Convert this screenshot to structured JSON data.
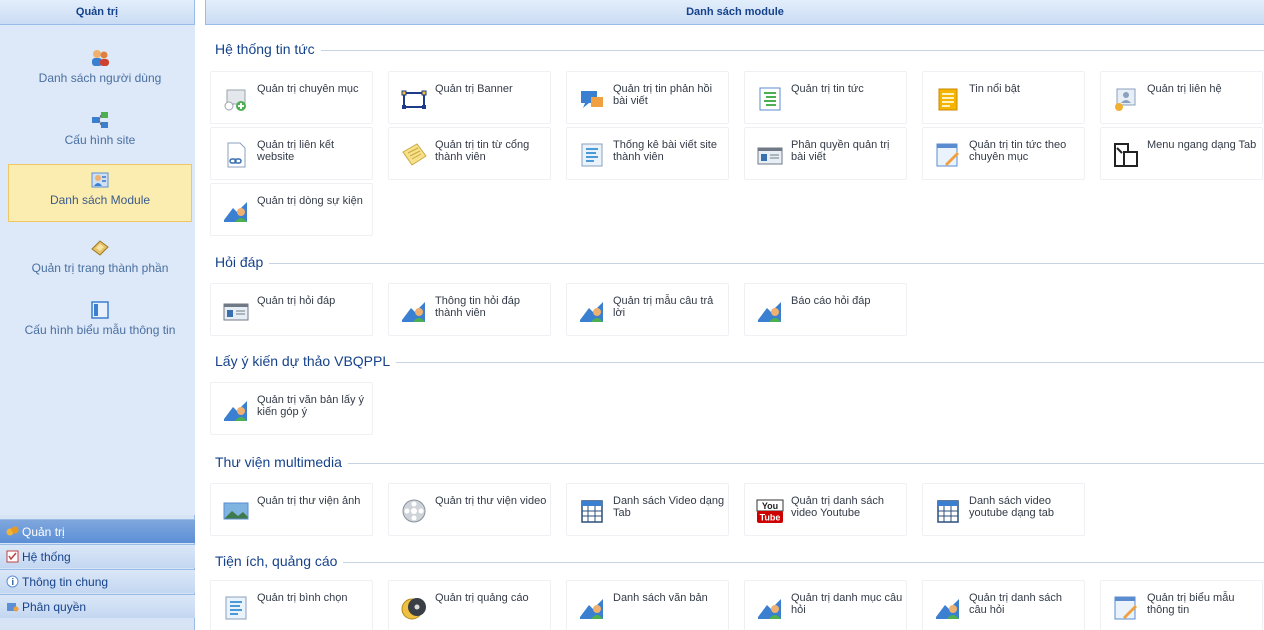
{
  "sidebar": {
    "title": "Quản trị",
    "items": [
      {
        "label": "Danh sách người dùng",
        "icon": "users-icon"
      },
      {
        "label": "Cấu hình site",
        "icon": "site-config-icon"
      },
      {
        "label": "Danh sách Module",
        "icon": "module-list-icon"
      },
      {
        "label": "Quản trị trang thành phần",
        "icon": "component-page-icon"
      },
      {
        "label": "Cấu hình biểu mẫu thông tin",
        "icon": "form-config-icon"
      }
    ],
    "accordion": [
      {
        "label": "Quản trị"
      },
      {
        "label": "Hệ thống"
      },
      {
        "label": "Thông tin chung"
      },
      {
        "label": "Phân quyền"
      }
    ]
  },
  "main": {
    "title": "Danh sách module",
    "sections": [
      {
        "title": "Hệ thống tin tức",
        "modules": [
          {
            "label": "Quản trị chuyên mục"
          },
          {
            "label": "Quản trị Banner"
          },
          {
            "label": "Quản trị tin phản hồi bài viết"
          },
          {
            "label": "Quản trị tin tức"
          },
          {
            "label": "Tin nổi bật"
          },
          {
            "label": "Quản trị liên hệ"
          },
          {
            "label": "Quản trị liên kết website"
          },
          {
            "label": "Quản trị tin từ cổng thành viên"
          },
          {
            "label": "Thống kê bài viết site thành viên"
          },
          {
            "label": "Phân quyền quản trị bài viết"
          },
          {
            "label": "Quản trị tin tức theo chuyên mục"
          },
          {
            "label": "Menu ngang dạng Tab"
          },
          {
            "label": "Quản trị dòng sự kiện"
          }
        ]
      },
      {
        "title": "Hỏi đáp",
        "modules": [
          {
            "label": "Quản trị hỏi đáp"
          },
          {
            "label": "Thông tin hỏi đáp thành viên"
          },
          {
            "label": "Quản trị mẫu câu trả lời"
          },
          {
            "label": "Báo cáo hỏi đáp"
          }
        ]
      },
      {
        "title": "Lấy ý kiến dự thảo VBQPPL",
        "modules": [
          {
            "label": "Quản trị văn bản lấy ý kiến góp ý"
          }
        ]
      },
      {
        "title": "Thư viện multimedia",
        "modules": [
          {
            "label": "Quản trị thư viện ảnh"
          },
          {
            "label": "Quản trị thư viện video"
          },
          {
            "label": "Danh sách Video dạng Tab"
          },
          {
            "label": "Quản trị danh sách video Youtube"
          },
          {
            "label": "Danh sách video youtube dạng tab"
          }
        ]
      },
      {
        "title": "Tiện ích, quảng cáo",
        "modules": [
          {
            "label": "Quản trị bình chọn"
          },
          {
            "label": "Quản trị quảng cáo"
          },
          {
            "label": "Danh sách văn bản"
          },
          {
            "label": "Quản trị danh mục câu hỏi"
          },
          {
            "label": "Quản trị danh sách câu hỏi"
          },
          {
            "label": "Quản trị biểu mẫu thông tin"
          }
        ]
      }
    ]
  },
  "youtube_icon": {
    "top": "You",
    "bottom": "Tube"
  },
  "colors": {
    "header_text": "#15428b",
    "active_nav_bg": "#fbecaf",
    "active_accordion": "#5c8fd6",
    "border": "#99bbe8"
  }
}
